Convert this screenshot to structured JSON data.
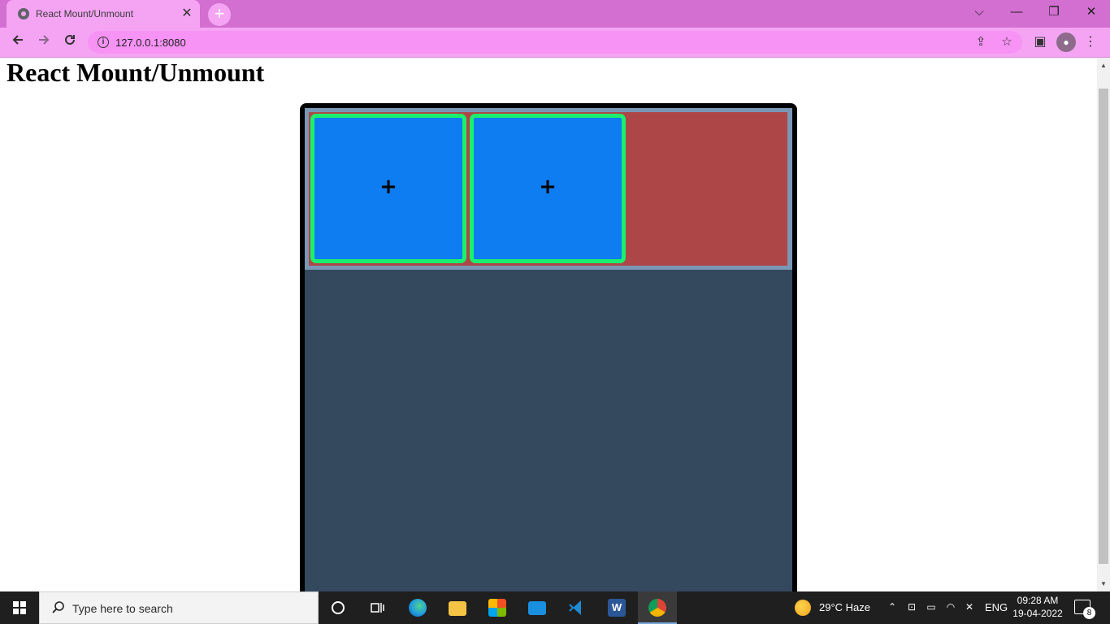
{
  "browser": {
    "tab_title": "React Mount/Unmount",
    "tab_close": "✕",
    "new_tab": "+",
    "url": "127.0.0.1:8080",
    "window_controls": {
      "menu": "⌵",
      "minimize": "—",
      "restore": "❐",
      "close": "✕"
    }
  },
  "page": {
    "title": "React Mount/Unmount",
    "cards": [
      {
        "symbol": "+"
      },
      {
        "symbol": "+"
      }
    ],
    "colors": {
      "frame": "#000000",
      "app_background": "#34495e",
      "row_border": "#7a97b5",
      "row_background": "#ad4747",
      "card_fill": "#0d7df1",
      "card_border": "#1bf06d"
    }
  },
  "taskbar": {
    "search_placeholder": "Type here to search",
    "weather": "29°C  Haze",
    "language": "ENG",
    "time": "09:28 AM",
    "date": "19-04-2022",
    "notification_count": "8",
    "apps": [
      "cortana",
      "task-view",
      "edge",
      "file-explorer",
      "microsoft-store",
      "mail",
      "vscode",
      "word",
      "chrome"
    ]
  }
}
